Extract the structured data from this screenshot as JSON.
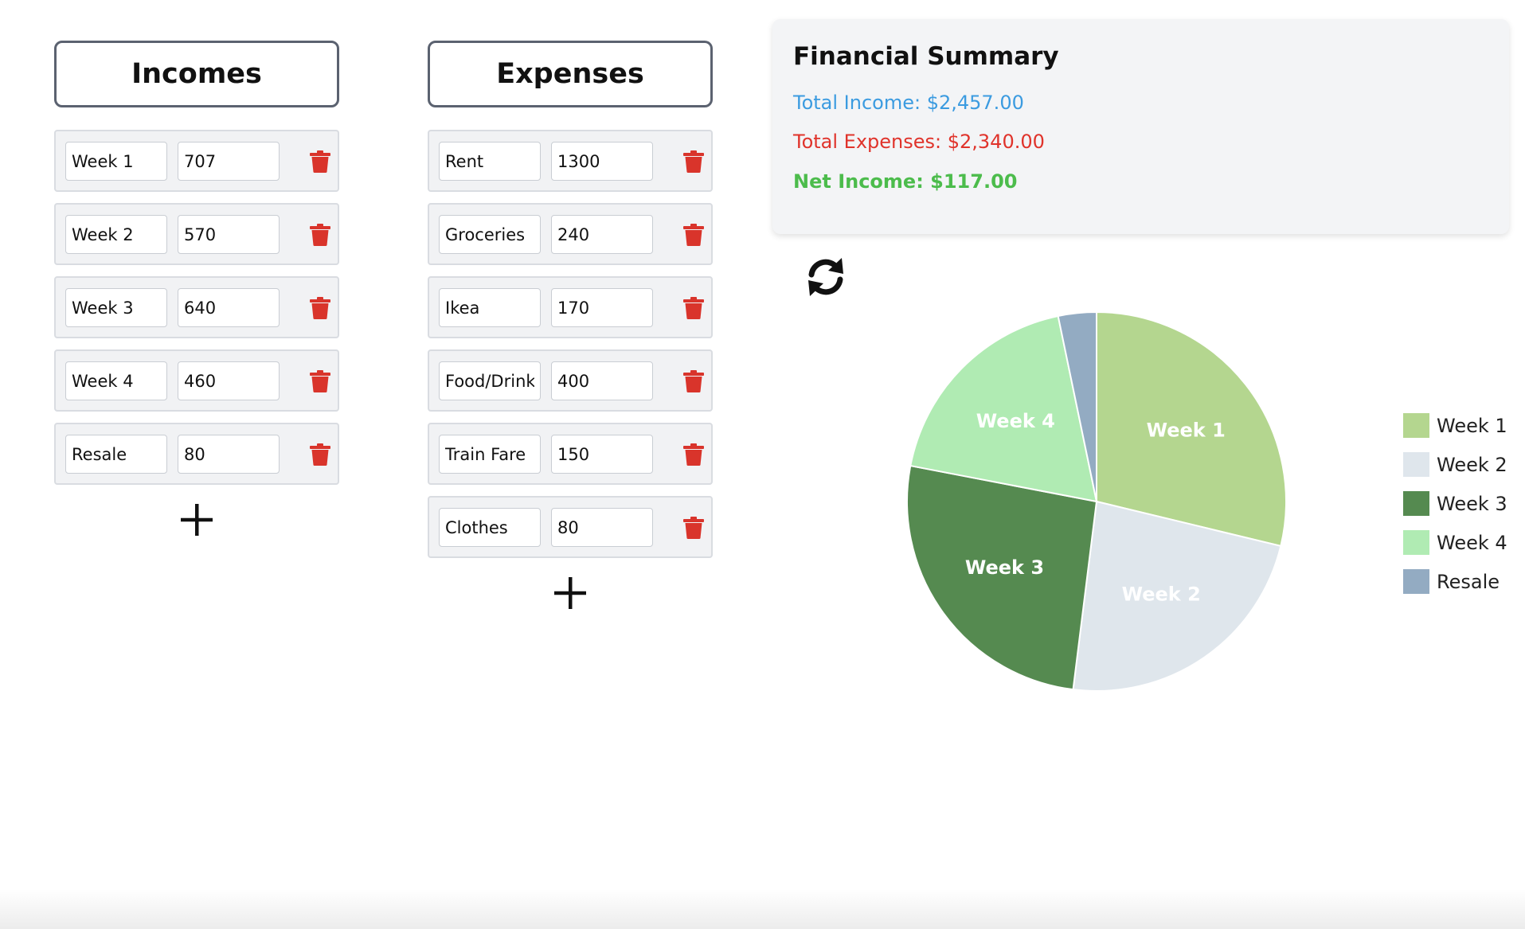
{
  "incomes": {
    "title": "Incomes",
    "items": [
      {
        "name": "Week 1",
        "amount": "707"
      },
      {
        "name": "Week 2",
        "amount": "570"
      },
      {
        "name": "Week 3",
        "amount": "640"
      },
      {
        "name": "Week 4",
        "amount": "460"
      },
      {
        "name": "Resale",
        "amount": "80"
      }
    ]
  },
  "expenses": {
    "title": "Expenses",
    "items": [
      {
        "name": "Rent",
        "amount": "1300"
      },
      {
        "name": "Groceries",
        "amount": "240"
      },
      {
        "name": "Ikea",
        "amount": "170"
      },
      {
        "name": "Food/Drink",
        "amount": "400"
      },
      {
        "name": "Train Fare",
        "amount": "150"
      },
      {
        "name": "Clothes",
        "amount": "80"
      }
    ]
  },
  "summary": {
    "title": "Financial Summary",
    "total_income": "Total Income: $2,457.00",
    "total_expenses": "Total Expenses: $2,340.00",
    "net_income": "Net Income: $117.00"
  },
  "icons": {
    "delete": "trash-icon",
    "add": "plus-icon",
    "refresh": "refresh-icon"
  },
  "colors": {
    "delete": "#d9342b",
    "income_text": "#3b9be0",
    "expense_text": "#e0332b",
    "net_text": "#4cbc4c"
  },
  "chart_data": {
    "type": "pie",
    "categories": [
      "Week 1",
      "Week 2",
      "Week 3",
      "Week 4",
      "Resale"
    ],
    "values": [
      707,
      570,
      640,
      460,
      80
    ],
    "colors": [
      "#b4d68f",
      "#dfe6ec",
      "#558a50",
      "#b0ebb3",
      "#93abc2"
    ],
    "slice_labels": [
      "Week 1",
      "Week 2",
      "Week 3",
      "Week 4",
      ""
    ],
    "legend_position": "right"
  }
}
